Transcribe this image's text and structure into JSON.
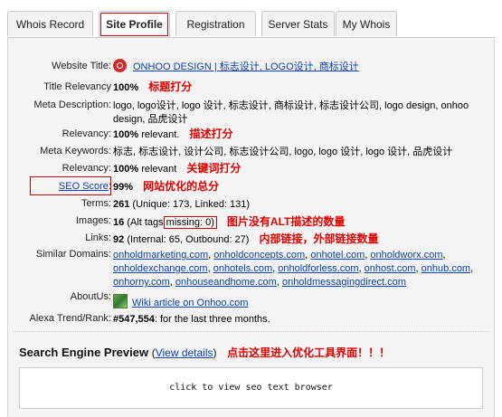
{
  "tabs": [
    {
      "label": "Whois Record"
    },
    {
      "label": "Site Profile",
      "active": true
    },
    {
      "label": "Registration"
    },
    {
      "label": "Server Stats"
    },
    {
      "label": "My Whois"
    }
  ],
  "profile": {
    "website_title": {
      "label": "Website Title:",
      "value": "ONHOO DESIGN | 标志设计, LOGO设计, 商标设计"
    },
    "title_relevancy": {
      "label": "Title Relevancy",
      "value": "100%",
      "note": "标题打分"
    },
    "meta_description": {
      "label": "Meta Description:",
      "value": "logo, logo设计, logo 设计, 标志设计, 商标设计, 标志设计公司, logo design, onhoo design, 品虎设计"
    },
    "desc_relevancy": {
      "label": "Relevancy:",
      "value": "100%",
      "suffix": "relevant.",
      "note": "描述打分"
    },
    "meta_keywords": {
      "label": "Meta Keywords:",
      "value": "标志, 标志设计, 设计公司, 标志设计公司, logo, logo 设计, logo 设计, 品虎设计"
    },
    "kw_relevancy": {
      "label": "Relevancy:",
      "value": "100%",
      "suffix": "relevant",
      "note": "关键词打分"
    },
    "seo_score": {
      "label": "SEO Score",
      "colon": ":",
      "value": "99%",
      "note": "网站优化的总分"
    },
    "terms": {
      "label": "Terms:",
      "value": "261",
      "detail": "(Unique: 173, Linked: 131)"
    },
    "images": {
      "label": "Images:",
      "value": "16",
      "detail_pre": "(Alt tags",
      "detail_box": "missing: 0)",
      "note": "图片没有ALT描述的数量"
    },
    "links": {
      "label": "Links:",
      "value": "92",
      "detail": "(Internal: 65, Outbound: 27)",
      "note": "内部链接，外部链接数量"
    },
    "similar_domains": {
      "label": "Similar Domains:",
      "items": [
        "onholdmarketing.com",
        "onholdconcepts.com",
        "onhotel.com",
        "onholdworx.com",
        "onholdexchange.com",
        "onhotels.com",
        "onholdforless.com",
        "onhost.com",
        "onhub.com",
        "onhorny.com",
        "onhouseandhome.com",
        "onholdmessagingdirect.com"
      ]
    },
    "about_us": {
      "label": "AboutUs:",
      "link": "Wiki article on Onhoo.com"
    },
    "alexa": {
      "label": "Alexa Trend/Rank:",
      "value": "#547,554",
      "detail": ": for the last three months."
    }
  },
  "preview": {
    "title": "Search Engine Preview",
    "paren_open": "(",
    "link": "View details",
    "paren_close": ")",
    "note": "点击这里进入优化工具界面！！！",
    "box_text": "click to view seo text browser"
  }
}
